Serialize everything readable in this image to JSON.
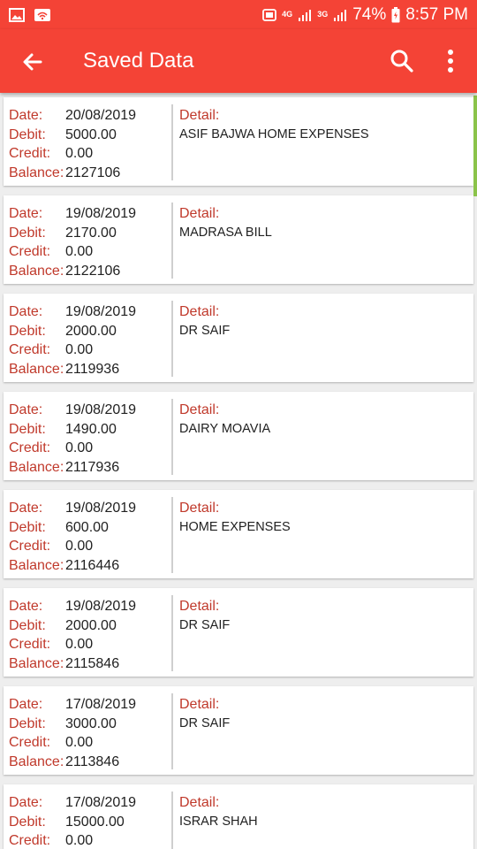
{
  "status_bar": {
    "network_1": "4G",
    "network_2": "3G",
    "battery": "74%",
    "time": "8:57 PM"
  },
  "toolbar": {
    "title": "Saved Data"
  },
  "labels": {
    "date": "Date:",
    "debit": "Debit:",
    "credit": "Credit:",
    "balance": "Balance:",
    "detail": "Detail:"
  },
  "records": [
    {
      "date": "20/08/2019",
      "debit": "5000.00",
      "credit": "0.00",
      "balance": "2127106",
      "detail": "ASIF BAJWA HOME EXPENSES"
    },
    {
      "date": "19/08/2019",
      "debit": "2170.00",
      "credit": "0.00",
      "balance": "2122106",
      "detail": "MADRASA BILL"
    },
    {
      "date": "19/08/2019",
      "debit": "2000.00",
      "credit": "0.00",
      "balance": "2119936",
      "detail": "DR SAIF"
    },
    {
      "date": "19/08/2019",
      "debit": "1490.00",
      "credit": "0.00",
      "balance": "2117936",
      "detail": "DAIRY MOAVIA"
    },
    {
      "date": "19/08/2019",
      "debit": "600.00",
      "credit": "0.00",
      "balance": "2116446",
      "detail": "HOME EXPENSES"
    },
    {
      "date": "19/08/2019",
      "debit": "2000.00",
      "credit": "0.00",
      "balance": "2115846",
      "detail": "DR SAIF"
    },
    {
      "date": "17/08/2019",
      "debit": "3000.00",
      "credit": "0.00",
      "balance": "2113846",
      "detail": "DR SAIF"
    },
    {
      "date": "17/08/2019",
      "debit": "15000.00",
      "credit": "0.00",
      "balance": "",
      "detail": "ISRAR SHAH"
    }
  ]
}
